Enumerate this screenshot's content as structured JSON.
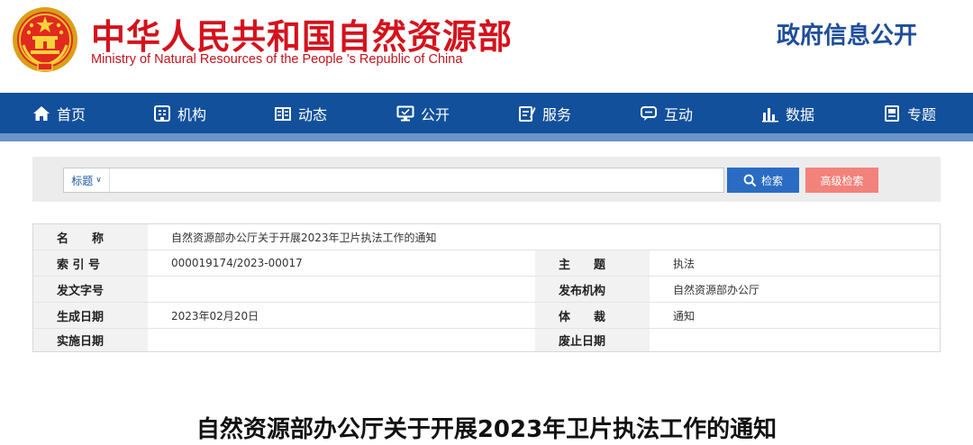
{
  "header": {
    "title_cn": "中华人民共和国自然资源部",
    "title_en": "Ministry of Natural Resources of the People ’s Republic of China",
    "gov_info": "政府信息公开"
  },
  "nav": {
    "items": [
      {
        "label": "首页",
        "icon": "home-icon"
      },
      {
        "label": "机构",
        "icon": "org-icon"
      },
      {
        "label": "动态",
        "icon": "news-icon"
      },
      {
        "label": "公开",
        "icon": "monitor-icon"
      },
      {
        "label": "服务",
        "icon": "service-icon"
      },
      {
        "label": "互动",
        "icon": "chat-icon"
      },
      {
        "label": "数据",
        "icon": "chart-icon"
      },
      {
        "label": "专题",
        "icon": "topic-icon"
      }
    ]
  },
  "search": {
    "type_label": "标题",
    "placeholder": "",
    "button_label": "检索",
    "advanced_label": "高级检索"
  },
  "info": {
    "name_label": "名　　称",
    "name_value": "自然资源部办公厅关于开展2023年卫片执法工作的通知",
    "index_label": "索 引 号",
    "index_value": "000019174/2023-00017",
    "subject_label": "主　　题",
    "subject_value": "执法",
    "doc_no_label": "发文字号",
    "doc_no_value": "",
    "issuer_label": "发布机构",
    "issuer_value": "自然资源部办公厅",
    "date_label": "生成日期",
    "date_value": "2023年02月20日",
    "genre_label": "体　　裁",
    "genre_value": "通知",
    "effective_label": "实施日期",
    "effective_value": "",
    "expiry_label": "废止日期",
    "expiry_value": ""
  },
  "article": {
    "title": "自然资源部办公厅关于开展2023年卫片执法工作的通知"
  },
  "colors": {
    "brand_red": "#d4121c",
    "nav_blue": "#12509c",
    "search_blue": "#2a6cc4",
    "advanced_pink": "#f2827a"
  }
}
